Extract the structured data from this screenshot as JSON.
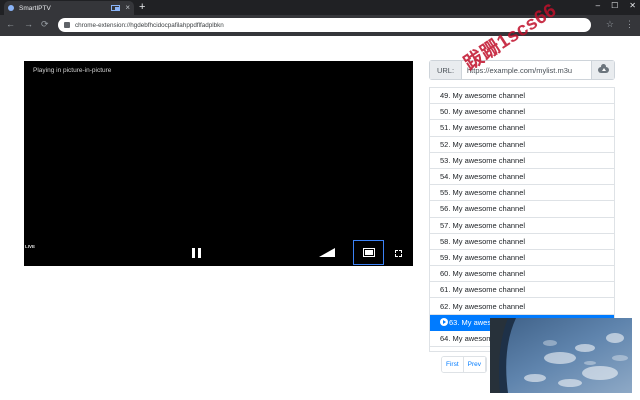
{
  "browser": {
    "tab_title": "SmartIPTV",
    "tab_close": "×",
    "new_tab": "+",
    "address": "chrome-extension://hgdebfhcidocpafilahppdflfadplbkn",
    "win_minimize": "–",
    "win_maximize": "☐",
    "win_close": "✕",
    "back": "←",
    "forward": "→",
    "reload": "⟳",
    "bookmark": "☆",
    "menu": "⋮"
  },
  "player": {
    "pip_message": "Playing in picture-in-picture",
    "live_badge": "LIVE",
    "controls": [
      "pause-icon",
      "volume-icon",
      "picture-in-picture-icon",
      "fullscreen-icon"
    ]
  },
  "url_bar": {
    "prefix": "URL:",
    "value": "https://example.com/mylist.m3u",
    "load_icon": "cloud-download-icon"
  },
  "channels": [
    "49. My awesome channel",
    "50. My awesome channel",
    "51. My awesome channel",
    "52. My awesome channel",
    "53. My awesome channel",
    "54. My awesome channel",
    "55. My awesome channel",
    "56. My awesome channel",
    "57. My awesome channel",
    "58. My awesome channel",
    "59. My awesome channel",
    "60. My awesome channel",
    "61. My awesome channel",
    "62. My awesome channel",
    "63. My awesome channel",
    "64. My awesome channel"
  ],
  "active_channel_index": 14,
  "pagination": {
    "first": "First",
    "prev": "Prev"
  },
  "watermark": "跋跚1scs66",
  "colors": {
    "accent": "#007bff",
    "pip_border": "#3b82f6",
    "chrome_dark": "#202124",
    "watermark": "#c0102b"
  }
}
